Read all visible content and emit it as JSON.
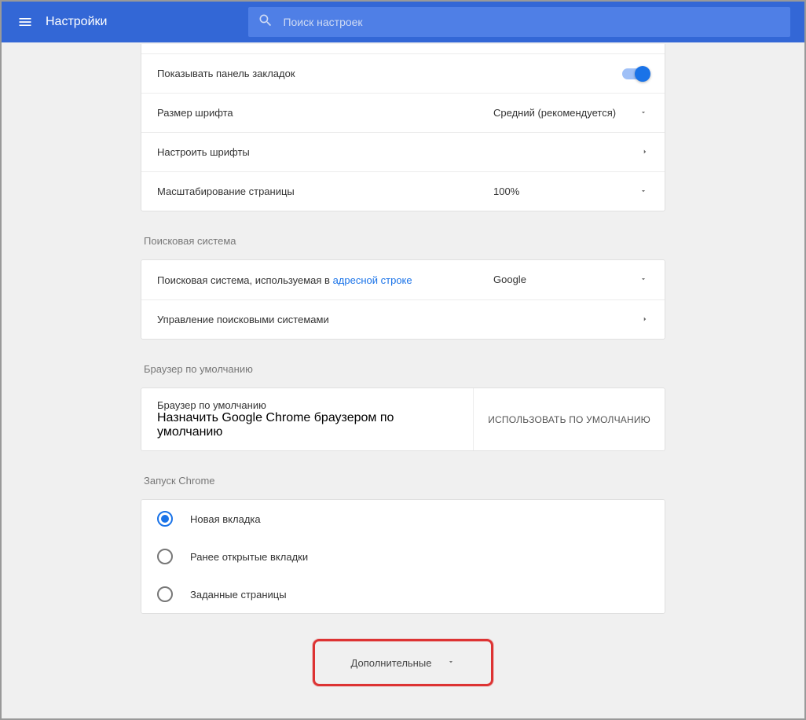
{
  "header": {
    "title": "Настройки",
    "search_placeholder": "Поиск настроек"
  },
  "appearance": {
    "bookmarks_bar": "Показывать панель закладок",
    "font_size_label": "Размер шрифта",
    "font_size_value": "Средний (рекомендуется)",
    "customize_fonts": "Настроить шрифты",
    "page_zoom_label": "Масштабирование страницы",
    "page_zoom_value": "100%"
  },
  "search_engine": {
    "section": "Поисковая система",
    "used_in_prefix": "Поисковая система, используемая в ",
    "used_in_link": "адресной строке",
    "selected": "Google",
    "manage": "Управление поисковыми системами"
  },
  "default_browser": {
    "section": "Браузер по умолчанию",
    "title": "Браузер по умолчанию",
    "sub": "Назначить Google Chrome браузером по умолчанию",
    "button": "ИСПОЛЬЗОВАТЬ ПО УМОЛЧАНИЮ"
  },
  "startup": {
    "section": "Запуск Chrome",
    "options": [
      {
        "label": "Новая вкладка",
        "checked": true
      },
      {
        "label": "Ранее открытые вкладки",
        "checked": false
      },
      {
        "label": "Заданные страницы",
        "checked": false
      }
    ]
  },
  "advanced": "Дополнительные"
}
